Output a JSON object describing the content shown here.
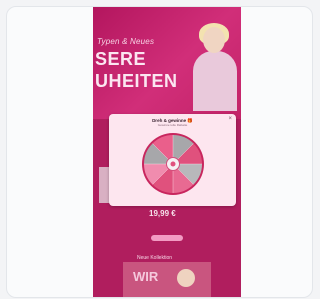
{
  "page": {
    "hero": {
      "small_text": "Typen & Neues",
      "line1": "SERE",
      "line2": "UHEITEN"
    },
    "prices": [
      "",
      "19,99 €",
      ""
    ],
    "section_title": "Neue Kollektion",
    "bottom_banner": "WIR"
  },
  "modal": {
    "title": "Dreh & gewinne 🎁",
    "subtitle": "Gewinne tolle Rabatte",
    "close_label": "×"
  },
  "colors": {
    "brand_pink": "#c91c6a",
    "wheel_pink": "#e0517d",
    "wheel_grey": "#a7a7aa",
    "modal_bg": "#fde6ef"
  }
}
